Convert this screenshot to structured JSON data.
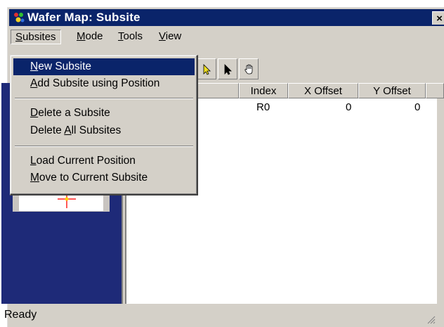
{
  "window": {
    "title": "Wafer Map: Subsite",
    "close_glyph": "×"
  },
  "menubar": {
    "items": [
      {
        "label": "Subsites",
        "mnemonic": "S",
        "rest": "ubsites"
      },
      {
        "label": "Mode",
        "mnemonic": "M",
        "rest": "ode"
      },
      {
        "label": "Tools",
        "mnemonic": "T",
        "rest": "ools"
      },
      {
        "label": "View",
        "mnemonic": "V",
        "rest": "iew"
      }
    ]
  },
  "dropdown": {
    "items": [
      {
        "label": "New Subsite",
        "pre": "",
        "mnemonic": "N",
        "post": "ew Subsite",
        "selected": true
      },
      {
        "label": "Add Subsite using Position",
        "pre": "",
        "mnemonic": "A",
        "post": "dd Subsite using Position"
      },
      {
        "label": "Delete a Subsite",
        "pre": "",
        "mnemonic": "D",
        "post": "elete a Subsite"
      },
      {
        "label": "Delete All Subsites",
        "pre": "Delete ",
        "mnemonic": "A",
        "post": "ll Subsites"
      },
      {
        "label": "Load Current Position",
        "pre": "",
        "mnemonic": "L",
        "post": "oad Current Position"
      },
      {
        "label": "Move to Current Subsite",
        "pre": "",
        "mnemonic": "M",
        "post": "ove to Current Subsite"
      }
    ]
  },
  "toolbar": {
    "buttons": [
      "arrow-blue-icon",
      "arrow-yellow-icon",
      "arrow-black-icon",
      "hand-icon"
    ]
  },
  "table": {
    "columns": [
      "Index",
      "X Offset",
      "Y Offset"
    ],
    "rows": [
      {
        "index": "R0",
        "x_offset": "0",
        "y_offset": "0"
      }
    ]
  },
  "status": {
    "text": "Ready"
  },
  "colors": {
    "title_bar": "#0a246a",
    "selection": "#0a246a",
    "panel": "#1e2a78",
    "chrome": "#d4d0c8",
    "die": "#a8763a"
  }
}
